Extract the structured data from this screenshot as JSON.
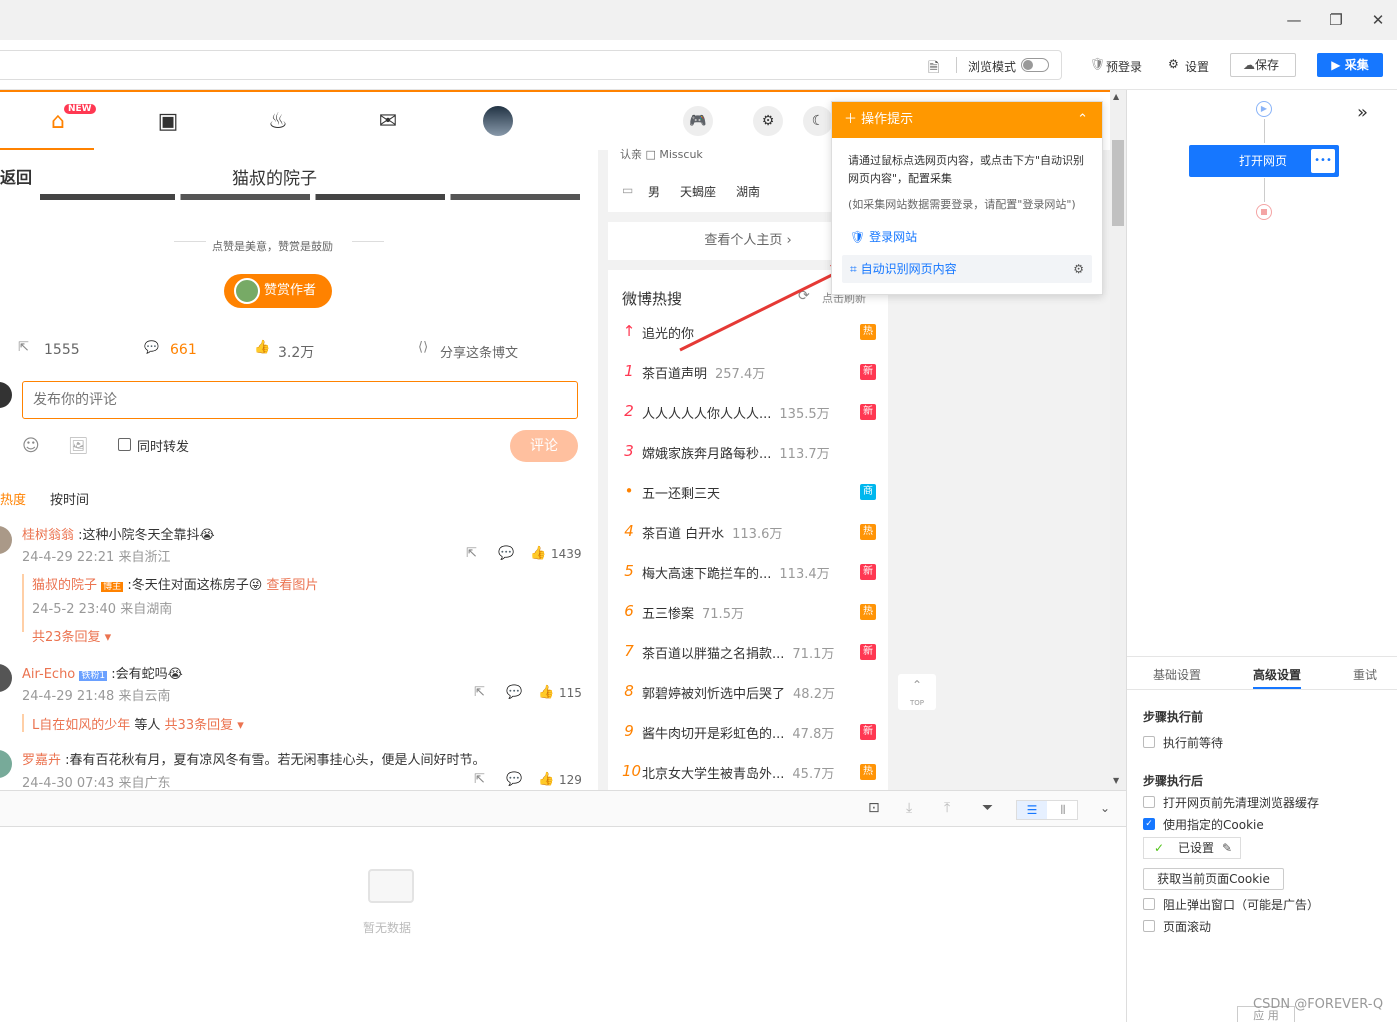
{
  "window": {
    "minimize": "—",
    "restore": "❐",
    "close": "✕"
  },
  "toolbar": {
    "browse_mode": "浏览模式",
    "prelogin": "预登录",
    "settings": "设置",
    "save": "保存",
    "collect": "采集"
  },
  "site": {
    "back": "返回",
    "page_title": "猫叔的院子",
    "encourage": "点赞是美意，赞赏是鼓励",
    "reward": "赞赏作者",
    "stats": {
      "repost": "1555",
      "comment": "661",
      "like": "3.2万",
      "share": "分享这条博文"
    },
    "comment_placeholder": "发布你的评论",
    "also_repost": "同时转发",
    "comment_btn": "评论",
    "sort_hot": "热度",
    "sort_time": "按时间",
    "comments": [
      {
        "name": "桂树翁翁",
        "text": ":这种小院冬天全靠抖😭",
        "meta": "24-4-29 22:21 来自浙江",
        "likes": "1439",
        "reply": {
          "name": "猫叔的院子",
          "badge": "博主",
          "text": ":冬天住对面这栋房子😜",
          "link": "查看图片",
          "meta": "24-5-2 23:40 来自湖南",
          "more": "共23条回复"
        }
      },
      {
        "name": "Air-Echo",
        "badge": "铁粉1",
        "text": ":会有蛇吗😭",
        "meta": "24-4-29 21:48 来自云南",
        "likes": "115",
        "reply_line": {
          "name": "L自在如风的少年",
          "mid": "等人",
          "more": "共33条回复"
        }
      },
      {
        "name": "罗嘉卉",
        "text": ":春有百花秋有月，夏有凉风冬有雪。若无闲事挂心头，便是人间好时节。",
        "meta": "24-4-30 07:43 来自广东",
        "likes": "129"
      }
    ],
    "profile": {
      "partial": "认亲 □ Misscuk",
      "gender": "男",
      "sign": "天蝎座",
      "city": "湖南",
      "view_home": "查看个人主页"
    },
    "hot": {
      "title": "微博热搜",
      "refresh": "点击刷新",
      "top_label": "TOP",
      "items": [
        {
          "rank": "↑",
          "name": "追光的你",
          "count": "",
          "badge": "热",
          "color": "#ff9406"
        },
        {
          "rank": "1",
          "name": "茶百道声明",
          "count": "257.4万",
          "badge": "新",
          "color": "#ff3852"
        },
        {
          "rank": "2",
          "name": "人人人人人你人人人...",
          "count": "135.5万",
          "badge": "新",
          "color": "#ff3852"
        },
        {
          "rank": "3",
          "name": "嫦娥家族奔月路每秒...",
          "count": "113.7万",
          "badge": "",
          "color": ""
        },
        {
          "rank": "•",
          "name": "五一还剩三天",
          "count": "",
          "badge": "商",
          "color": "#00b7ee"
        },
        {
          "rank": "4",
          "name": "茶百道 白开水",
          "count": "113.6万",
          "badge": "热",
          "color": "#ff9406"
        },
        {
          "rank": "5",
          "name": "梅大高速下跪拦车的...",
          "count": "113.4万",
          "badge": "新",
          "color": "#ff3852"
        },
        {
          "rank": "6",
          "name": "五三惨案",
          "count": "71.5万",
          "badge": "热",
          "color": "#ff9406"
        },
        {
          "rank": "7",
          "name": "茶百道以胖猫之名捐款...",
          "count": "71.1万",
          "badge": "新",
          "color": "#ff3852"
        },
        {
          "rank": "8",
          "name": "郭碧婷被刘忻选中后哭了",
          "count": "48.2万",
          "badge": "",
          "color": ""
        },
        {
          "rank": "9",
          "name": "酱牛肉切开是彩虹色的...",
          "count": "47.8万",
          "badge": "新",
          "color": "#ff3852"
        },
        {
          "rank": "10",
          "name": "北京女大学生被青岛外...",
          "count": "45.7万",
          "badge": "热",
          "color": "#ff9406"
        }
      ]
    }
  },
  "tip": {
    "title": "操作提示",
    "desc": "请通过鼠标点选网页内容，或点击下方\"自动识别网页内容\"，配置采集",
    "note": "(如采集网站数据需要登录，请配置\"登录网站\")",
    "login": "登录网站",
    "auto": "自动识别网页内容"
  },
  "bottom": {
    "empty": "暂无数据"
  },
  "panel": {
    "open_page": "打开网页",
    "more": "•••",
    "tabs": [
      "基础设置",
      "高级设置",
      "重试"
    ],
    "before": "步骤执行前",
    "wait": "执行前等待",
    "after": "步骤执行后",
    "clear_cache": "打开网页前先清理浏览器缓存",
    "use_cookie": "使用指定的Cookie",
    "set": "已设置",
    "get_cookie": "获取当前页面Cookie",
    "block_popup": "阻止弹出窗口（可能是广告）",
    "scroll": "页面滚动",
    "apply": "应 用"
  },
  "watermark": "CSDN @FOREVER-Q"
}
